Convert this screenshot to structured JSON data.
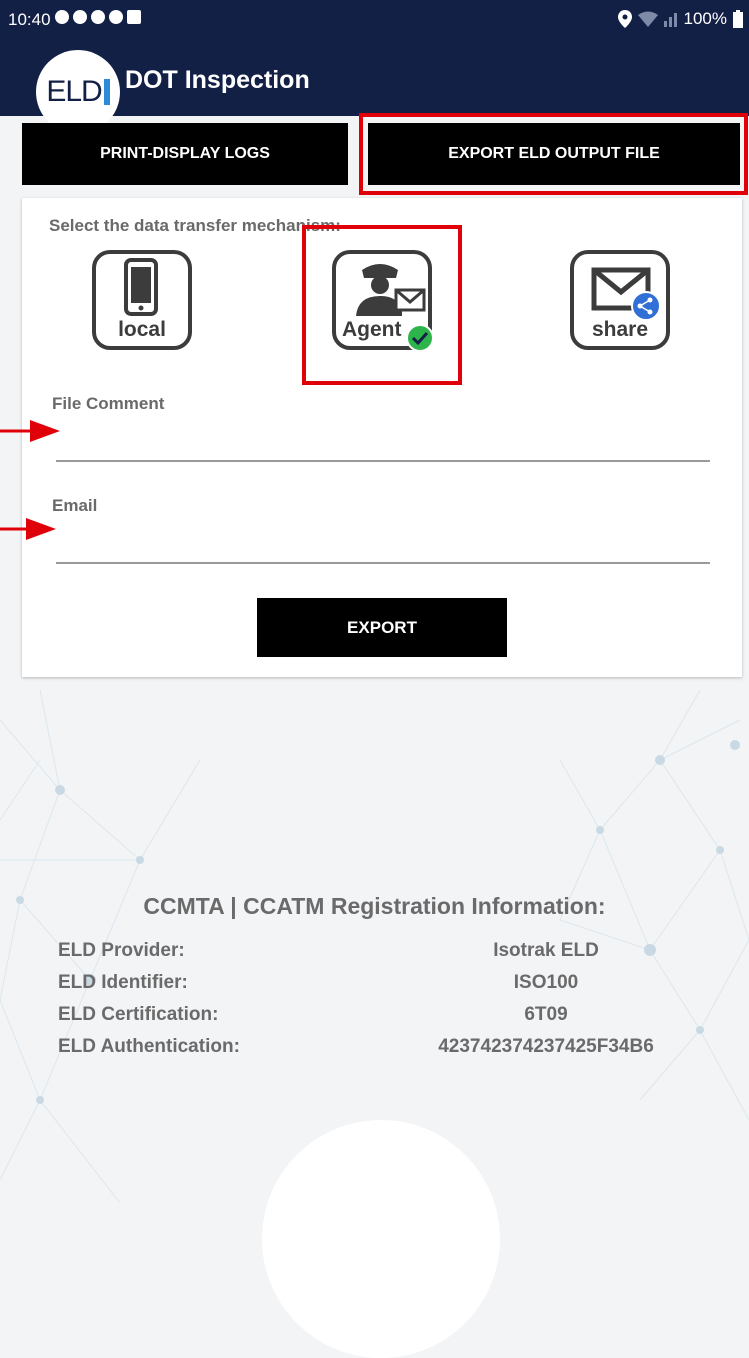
{
  "status_bar": {
    "time": "10:40",
    "battery": "100%"
  },
  "app_bar": {
    "logo": "ELD",
    "title": "DOT Inspection"
  },
  "tabs": {
    "print_label": "PRINT-DISPLAY LOGS",
    "export_label": "EXPORT ELD OUTPUT FILE",
    "active": "export"
  },
  "card": {
    "prompt": "Select the data transfer mechanism:",
    "mechanisms": [
      {
        "id": "local",
        "label": "local",
        "icon": "phone-icon",
        "selected": false
      },
      {
        "id": "agent",
        "label": "Agent",
        "icon": "officer-mail-icon",
        "selected": true
      },
      {
        "id": "share",
        "label": "share",
        "icon": "mail-share-icon",
        "selected": false
      }
    ],
    "file_comment": {
      "label": "File Comment",
      "value": "",
      "placeholder": ""
    },
    "email": {
      "label": "Email",
      "value": "",
      "placeholder": ""
    },
    "export_button": "EXPORT"
  },
  "registration": {
    "title": "CCMTA | CCATM Registration Information:",
    "rows": [
      {
        "key": "ELD Provider:",
        "value": "Isotrak ELD"
      },
      {
        "key": "ELD Identifier:",
        "value": "ISO100"
      },
      {
        "key": "ELD Certification:",
        "value": "6T09"
      },
      {
        "key": "ELD Authentication:",
        "value": "423742374237425F34B6"
      }
    ]
  },
  "colors": {
    "app_bar": "#132046",
    "highlight": "#e0000a",
    "button": "#000000",
    "selected_check": "#2db44a",
    "share_badge": "#2f6fd6"
  }
}
